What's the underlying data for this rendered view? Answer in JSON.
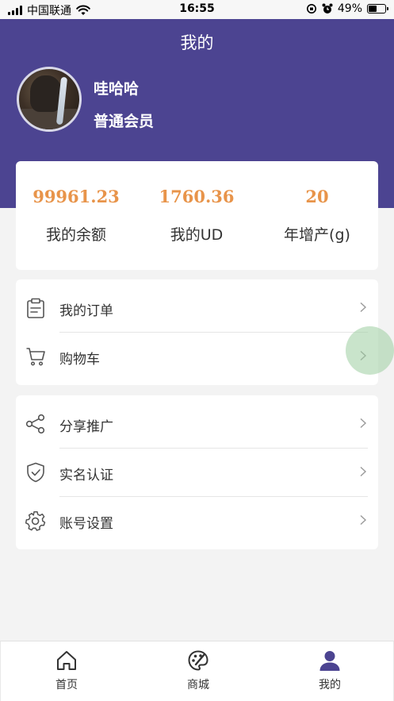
{
  "status_bar": {
    "carrier": "中国联通",
    "time": "16:55",
    "battery": "49%",
    "battery_level": 0.49
  },
  "header": {
    "title": "我的"
  },
  "profile": {
    "name": "哇哈哈",
    "level": "普通会员"
  },
  "stats": [
    {
      "value": "99961.23",
      "label": "我的余额"
    },
    {
      "value": "1760.36",
      "label": "我的UD"
    },
    {
      "value": "20",
      "label": "年增产(g)"
    }
  ],
  "menu_group_1": [
    {
      "label": "我的订单",
      "icon": "clipboard-icon"
    },
    {
      "label": "购物车",
      "icon": "cart-icon"
    }
  ],
  "menu_group_2": [
    {
      "label": "分享推广",
      "icon": "share-icon"
    },
    {
      "label": "实名认证",
      "icon": "shield-check-icon"
    },
    {
      "label": "账号设置",
      "icon": "gear-icon"
    }
  ],
  "tabbar": [
    {
      "label": "首页",
      "icon": "home-icon",
      "active": false
    },
    {
      "label": "商城",
      "icon": "palette-icon",
      "active": false
    },
    {
      "label": "我的",
      "icon": "user-icon",
      "active": true
    }
  ],
  "colors": {
    "brand": "#4c4491",
    "stat_value": "#e8944a",
    "page_bg": "#f3f3f3"
  }
}
